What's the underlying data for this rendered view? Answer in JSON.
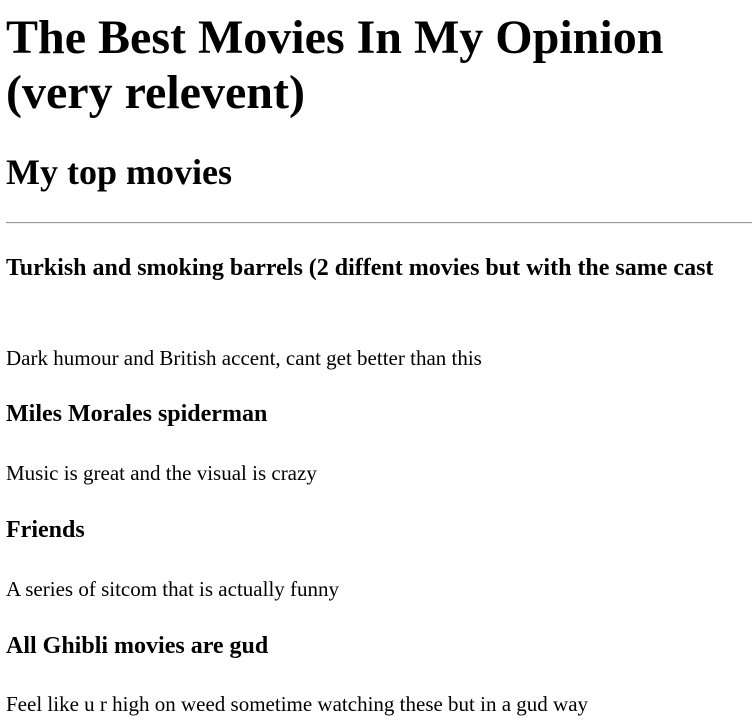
{
  "page": {
    "title": "The Best Movies In My Opinion (very relevent)",
    "subtitle": "My top movies"
  },
  "movies": [
    {
      "title": "Turkish and smoking barrels (2 diffent movies but with the same cast",
      "description": "Dark humour and British accent, cant get better than this"
    },
    {
      "title": "Miles Morales spiderman",
      "description": "Music is great and the visual is crazy"
    },
    {
      "title": "Friends",
      "description": "A series of sitcom that is actually funny"
    },
    {
      "title": "All Ghibli movies are gud",
      "description": "Feel like u r high on weed sometime watching these but in a gud way"
    }
  ]
}
